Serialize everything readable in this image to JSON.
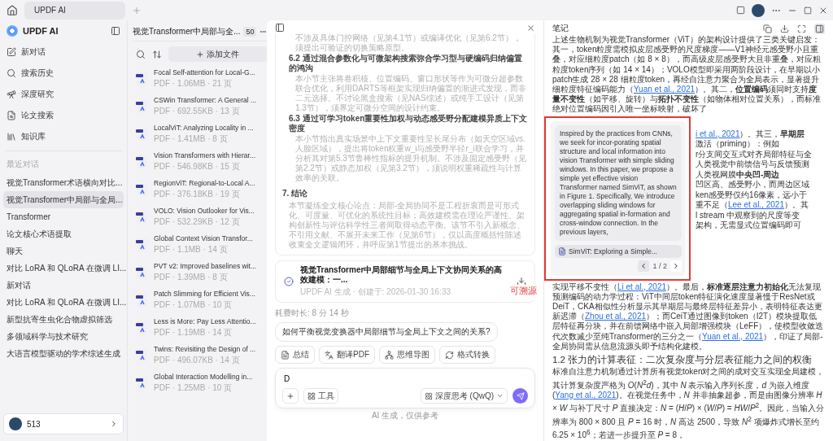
{
  "window": {
    "tab": "UPDF AI"
  },
  "sidebar": {
    "brand": "UPDF AI",
    "nav": [
      {
        "kind": "new",
        "label": "新对话"
      },
      {
        "kind": "history",
        "label": "搜索历史"
      },
      {
        "kind": "research",
        "label": "深度研究"
      },
      {
        "kind": "papers",
        "label": "论文搜索"
      },
      {
        "kind": "library",
        "label": "知识库"
      }
    ],
    "recent_label": "最近对话",
    "recent": [
      {
        "label": "视觉Transformer术语横向对比...",
        "selected": false
      },
      {
        "label": "视觉Transformer中局部与全局...",
        "selected": true
      },
      {
        "label": "Transformer",
        "selected": false
      },
      {
        "label": "论文核心术语提取",
        "selected": false
      },
      {
        "label": "聊天",
        "selected": false
      },
      {
        "label": "对比 LoRA 和 QLoRA 在微调 LI...",
        "selected": false
      },
      {
        "label": "新对话",
        "selected": false
      },
      {
        "label": "对比 LoRA 和 QLoRA 在微调 LI...",
        "selected": false
      },
      {
        "label": "新型抗寄生虫化合物虚拟筛选",
        "selected": false
      },
      {
        "label": "多领域科学与技术研究",
        "selected": false
      },
      {
        "label": "大语言模型驱动的学术综述生成",
        "selected": false
      }
    ],
    "user": {
      "credits": "513"
    }
  },
  "files": {
    "title": "视觉Transformer中局部与全...",
    "count": "50",
    "add_button": "添加文件",
    "items": [
      {
        "title": "Focal Self-attention for Local-G...",
        "meta": "PDF · 1.06MB · 21 页"
      },
      {
        "title": "CSWin Transformer: A General ...",
        "meta": "PDF · 692.55KB · 13 页"
      },
      {
        "title": "LocalViT: Analyzing Locality in ...",
        "meta": "PDF · 1.41MB · 8 页"
      },
      {
        "title": "Vision Transformers with Hierar...",
        "meta": "PDF · 546.98KB · 15 页"
      },
      {
        "title": "RegionViT: Regional-to-Local A...",
        "meta": "PDF · 376.18KB · 19 页"
      },
      {
        "title": "VOLO: Vision Outlooker for Vis...",
        "meta": "PDF · 532.29KB · 12 页"
      },
      {
        "title": "Global Context Vision Transfor...",
        "meta": "PDF · 1.1MB · 14 页"
      },
      {
        "title": "PVT v2: Improved baselines wit...",
        "meta": "PDF · 1.39MB · 8 页"
      },
      {
        "title": "Patch Slimming for Efficient Vis...",
        "meta": "PDF · 1.07MB · 10 页"
      },
      {
        "title": "Less is More: Pay Less Attentio...",
        "meta": "PDF · 1.19MB · 14 页"
      },
      {
        "title": "Twins: Revisiting the Design of ...",
        "meta": "PDF · 496.07KB · 14 页"
      },
      {
        "title": "Global Interaction Modelling in...",
        "meta": "PDF · 1.25MB · 10 页"
      }
    ]
  },
  "chat": {
    "outline": [
      {
        "kind": "body",
        "text": "不涉及具体门控网络（见第4.1节）或编译优化（见第6.2节），须提出可验证的切换策略原型。"
      },
      {
        "kind": "subheading",
        "text": "6.2 通过混合参数化与可微架构搜索弥合学习型与硬编码归纳偏置的鸿沟"
      },
      {
        "kind": "body",
        "text": "本小节主张将卷积核、位置编码、窗口形状等作为可微分超参数联合优化，利用DARTS等框架实现归纳偏置的渐进式发现，而非二元选择。不讨论黑盒搜索（见NAS综述）或纯手工设计（见第1.3节），须界定可微分空间的设计约束。"
      },
      {
        "kind": "subheading",
        "text": "6.3 通过可学习token重要性加权与动态感受野分配建模异质上下文密度"
      },
      {
        "kind": "body",
        "text": "本小节指出真实场景中上下文重要性呈长尾分布（如天空区域vs.人脸区域），提出将token权重w_i与感受野半径r_i联合学习，并分析其对第5.3节鲁棒性指标的提升机制。不涉及固定感受野（见第2.2节）或静态加权（见第3.2节），须说明权重稀疏性与计算效率的关联。"
      },
      {
        "kind": "heading",
        "text": "7. 结论"
      },
      {
        "kind": "summary",
        "text": "本节凝练全文核心论点：局部-全局协同不是工程折衷而是可形式化、可度量、可优化的系统性目标；高效建模需在理论严谨性、架构创新性与评估科学性三者间取得动态平衡。该节不引入新概念、不引用文献、不展开未来工作（见第6节），仅以高度概括性陈述收束全文逻辑闭环，并呼应第1节提出的基本挑战。"
      }
    ],
    "document": {
      "title": "视觉Transformer中局部细节与全局上下文协同关系的高效建模：一...",
      "meta": "UPDF AI 生成 · 创建于: 2026-01-30 16:33"
    },
    "duration": "耗费时长: 8 分 14 秒",
    "suggestion": "如何平衡视觉变换器中局部细节与全局上下文之间的关系?",
    "actions": [
      {
        "kind": "summary",
        "label": "总结"
      },
      {
        "kind": "translate",
        "label": "翻译PDF"
      },
      {
        "kind": "mindmap",
        "label": "思维导图"
      },
      {
        "kind": "convert",
        "label": "格式转换"
      }
    ],
    "input": {
      "value": "D",
      "tools": "工具",
      "model": "深度思考 (QwQ)"
    },
    "footer": "AI 生成，仅供参考"
  },
  "notes": {
    "title": "笔记",
    "intro": [
      {
        "kind": "text",
        "text": "上述生物机制为视觉Transformer（ViT）的架构设计提供了三类关键启发：其一，token粒度需模拟皮层感受野的尺度梯度——V1神经元感受野小且重叠，对应细粒度patch（如 8 × 8），而高级皮层感受野大且非重叠，对应粗粒度token序列（如 14 × 14）；VOLO模型即采用两阶段设计，在早期以小patch生成 28 × 28 细粒度token，再经自注意力聚合为全局表示，显著提升细粒度特征编码能力（"
      },
      {
        "kind": "link",
        "text": "Yuan et al., 2021"
      },
      {
        "kind": "text",
        "text": "）。其二，**位置编码**须同时支持**度量不变性**（如平移、旋转）与**拓扑不变性**（如物体相对位置关系），而标准绝对位置编码因引入唯一坐标映射，破坏了"
      }
    ],
    "fragments": [
      [
        {
          "kind": "link",
          "text": "i et al., 2021"
        },
        {
          "kind": "text",
          "text": "）。其三，**早期层**"
        }
      ],
      [
        {
          "kind": "text",
          "text": "激活（priming）：例如"
        }
      ],
      [
        {
          "kind": "text",
          "text": "r分支间交互式对齐局部特征与全"
        }
      ],
      [
        {
          "kind": "text",
          "text": "人类视觉中前馈信号与反馈预测"
        }
      ],
      [
        {
          "kind": "text",
          "text": "人类视网膜**中央凹-周边**"
        }
      ],
      [
        {
          "kind": "text",
          "text": "凹区高、感受野小，而周边区域"
        }
      ],
      [
        {
          "kind": "text",
          "text": "ken感受野仅约16像素，远小于"
        }
      ],
      [
        {
          "kind": "text",
          "text": "重不足（"
        },
        {
          "kind": "link",
          "text": "Lee et al., 2021"
        },
        {
          "kind": "text",
          "text": "）。其"
        }
      ],
      [
        {
          "kind": "text",
          "text": "l stream 中观察到的尺度等变"
        }
      ],
      [
        {
          "kind": "text",
          "text": "架构，无需显式位置编码即可"
        }
      ]
    ],
    "source_popup": {
      "quote": "Inspired by the practices from CNNs, we seek for incor-porating spatial structure and local information into vision Transformer with simple sliding windows. In this paper, we propose a simple yet effective vision Transformer named SimViT, as shown in Figure 1. Specifically, We introduce overlapping sliding windows for aggregating spatial in-formation and cross-window connection. In the previous layers,",
      "source": "SimViT: Exploring a Simple...",
      "pager": "1 / 2"
    },
    "annotation": "可溯源",
    "body": [
      {
        "kind": "text",
        "text": "实现平移不变性（"
      },
      {
        "kind": "link",
        "text": "Li et al., 2021"
      },
      {
        "kind": "text",
        "text": "）。最后，**标准逐层注意力初始化**无法复现预测编码的动力学过程：ViT中间层token特征演化速度显著慢于ResNet或DeiT，CKA相似性分析显示其早期层与最终层特征差异小，表明特征表达更新迟滞（"
      },
      {
        "kind": "link",
        "text": "Zhou et al., 2021"
      },
      {
        "kind": "text",
        "text": "）；而CeiT通过图像到token（I2T）模块提取低层特征再分块，并在前馈网络中嵌入局部增强模块（LeFF），使模型收敛迭代次数减少至纯Transformer的三分之一（"
      },
      {
        "kind": "link",
        "text": "Yuan et al., 2021"
      },
      {
        "kind": "text",
        "text": "），印证了局部-全局协同需从信息流源头即予结构化建模。"
      }
    ],
    "heading": "1.2 张力的计算表征：二次复杂度与分层表征能力之间的权衡",
    "body2": [
      {
        "kind": "text",
        "text": "标准自注意力机制通过计算所有视觉token对之间的成对交互实现全局建模，其计算复杂度严格为 *O*(*N*$^{2}$*d*)，其中 *N* 表示输入序列长度，*d* 为嵌入维度 ("
      },
      {
        "kind": "link",
        "text": "Yang et al., 2021"
      },
      {
        "kind": "text",
        "text": ")。在视觉任务中，*N* 并非抽象超参，而是由图像分辨率 *H* × *W* 与补丁尺寸 *P* 直接决定：*N* = (*H*/*P*) × (*W*/*P*) = *HW*/*P*$^{2}$。因此，当输入分辨率为 800 × 800 且 *P* = 16 时，*N* 高达 2500，导致 *N*$^{2}$ 项爆炸式增长至约 6.25 × 10$^{6}$；若进一步提升至 *P* = 8，"
      }
    ]
  }
}
